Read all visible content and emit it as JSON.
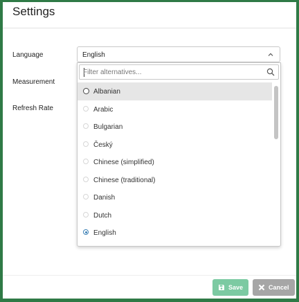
{
  "dialog": {
    "title": "Settings",
    "labels": {
      "language": "Language",
      "measurement": "Measurement",
      "refresh_rate": "Refresh Rate"
    },
    "language_select": {
      "selected_value": "English",
      "filter_placeholder": "Filter alternatives...",
      "options": [
        {
          "label": "Albanian",
          "state": "hover"
        },
        {
          "label": "Arabic",
          "state": ""
        },
        {
          "label": "Bulgarian",
          "state": ""
        },
        {
          "label": "Český",
          "state": ""
        },
        {
          "label": "Chinese (simplified)",
          "state": ""
        },
        {
          "label": "Chinese (traditional)",
          "state": ""
        },
        {
          "label": "Danish",
          "state": ""
        },
        {
          "label": "Dutch",
          "state": ""
        },
        {
          "label": "English",
          "state": "selected"
        }
      ]
    },
    "buttons": {
      "save": "Save",
      "cancel": "Cancel"
    },
    "icons": {
      "chevron": "chevron-up-icon",
      "search": "search-icon",
      "save": "floppy-disk-icon",
      "cancel": "close-icon"
    },
    "colors": {
      "background": "#2f7a46",
      "save_button": "#7ccaa2",
      "cancel_button": "#a6a6a6",
      "radio_selected": "#3c80b5"
    }
  }
}
